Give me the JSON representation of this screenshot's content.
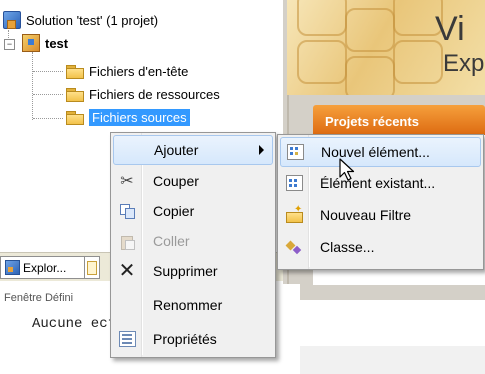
{
  "tree": {
    "solution_label": "Solution 'test' (1 projet)",
    "project_label": "test",
    "expander_symbol": "−",
    "folders": [
      {
        "label": "Fichiers d'en-tête"
      },
      {
        "label": "Fichiers de ressources"
      },
      {
        "label": "Fichiers sources"
      }
    ]
  },
  "start_page": {
    "banner_title": "Vi",
    "banner_subtitle": "Exp",
    "recent_projects_title": "Projets récents"
  },
  "bottom": {
    "tabs": [
      {
        "label": "Explor..."
      }
    ],
    "definition_window_title": "Fenêtre Défini",
    "definition_text": "Aucune         ectionnée"
  },
  "context_menu": {
    "items": [
      {
        "label": "Ajouter",
        "icon": "none",
        "submenu": true,
        "highlighted": true
      },
      {
        "label": "Couper",
        "icon": "scissors-icon"
      },
      {
        "label": "Copier",
        "icon": "copy-icon"
      },
      {
        "label": "Coller",
        "icon": "paste-icon",
        "disabled": true
      },
      {
        "label": "Supprimer",
        "icon": "delete-icon"
      },
      {
        "label": "Renommer",
        "icon": "none"
      },
      {
        "label": "Propriétés",
        "icon": "properties-icon"
      }
    ]
  },
  "submenu": {
    "items": [
      {
        "label": "Nouvel élément...",
        "icon": "new-item-icon",
        "highlighted": true
      },
      {
        "label": "Élément existant...",
        "icon": "existing-item-icon"
      },
      {
        "label": "Nouveau Filtre",
        "icon": "new-filter-icon"
      },
      {
        "label": "Classe...",
        "icon": "class-icon"
      }
    ]
  },
  "colors": {
    "selection": "#3399ff",
    "menu_background": "#f0f0f0",
    "menu_highlight": "#d6e8fc",
    "recent_header": "#e8811f"
  }
}
